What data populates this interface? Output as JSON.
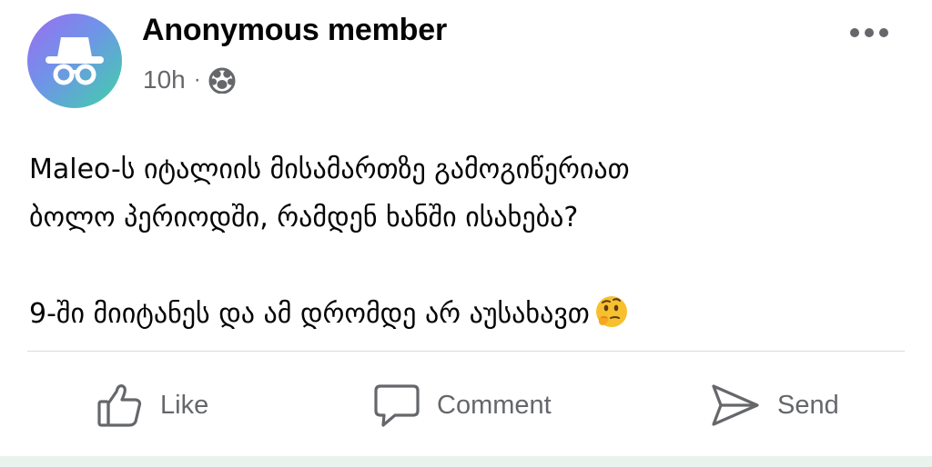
{
  "post": {
    "author": "Anonymous member",
    "time": "10h",
    "separator": "·",
    "privacy_icon": "group-icon",
    "avatar_icon": "incognito-icon",
    "more_icon": "more-dots-icon",
    "text_lines": [
      "Maleo-ს იტალიის მისამართზე გამოგიწერიათ",
      "ბოლო პერიოდში, რამდენ ხანში ისახება?",
      "9-ში მიიტანეს და ამ დრომდე არ აუსახავთ"
    ],
    "emoji": "thinking-face"
  },
  "actions": {
    "like_label": "Like",
    "comment_label": "Comment",
    "send_label": "Send",
    "like_icon": "thumbs-up-icon",
    "comment_icon": "comment-icon",
    "send_icon": "send-icon"
  },
  "colors": {
    "author": "#050505",
    "secondary": "#65676b",
    "divider": "#d7d9dd",
    "bottom_strip": "#e9f3ee",
    "avatar_gradient_start": "#9b6df0",
    "avatar_gradient_end": "#3fd2a6"
  }
}
